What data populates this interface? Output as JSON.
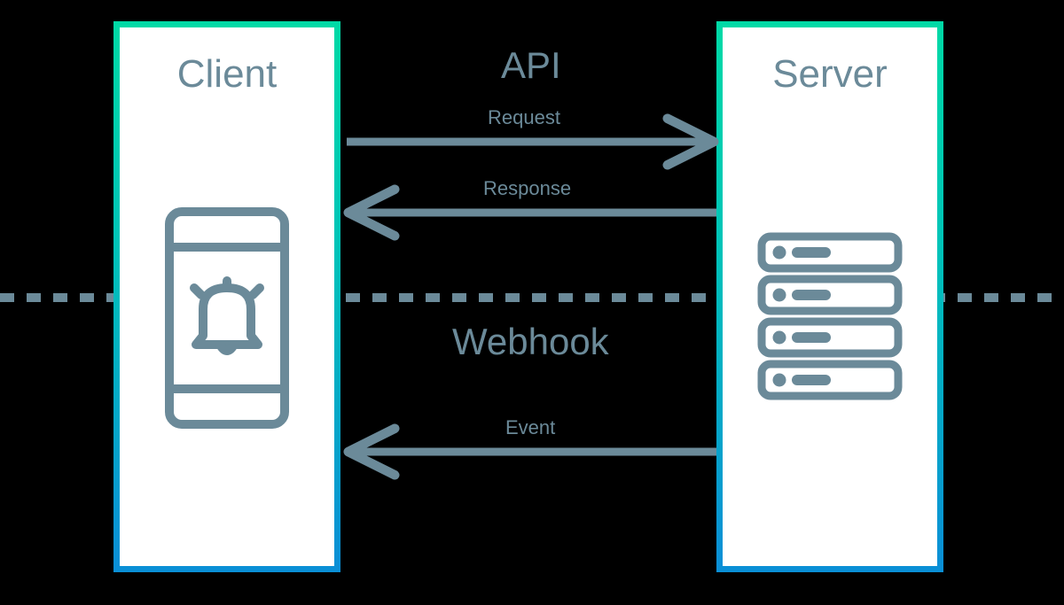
{
  "client": {
    "title": "Client"
  },
  "server": {
    "title": "Server"
  },
  "sections": {
    "api": "API",
    "webhook": "Webhook"
  },
  "arrows": {
    "request": "Request",
    "response": "Response",
    "event": "Event"
  },
  "colors": {
    "line": "#6b8a99",
    "gradient_top": "#00d9a6",
    "gradient_bottom": "#0a8fd6",
    "bg": "#000000",
    "box_bg": "#ffffff"
  }
}
